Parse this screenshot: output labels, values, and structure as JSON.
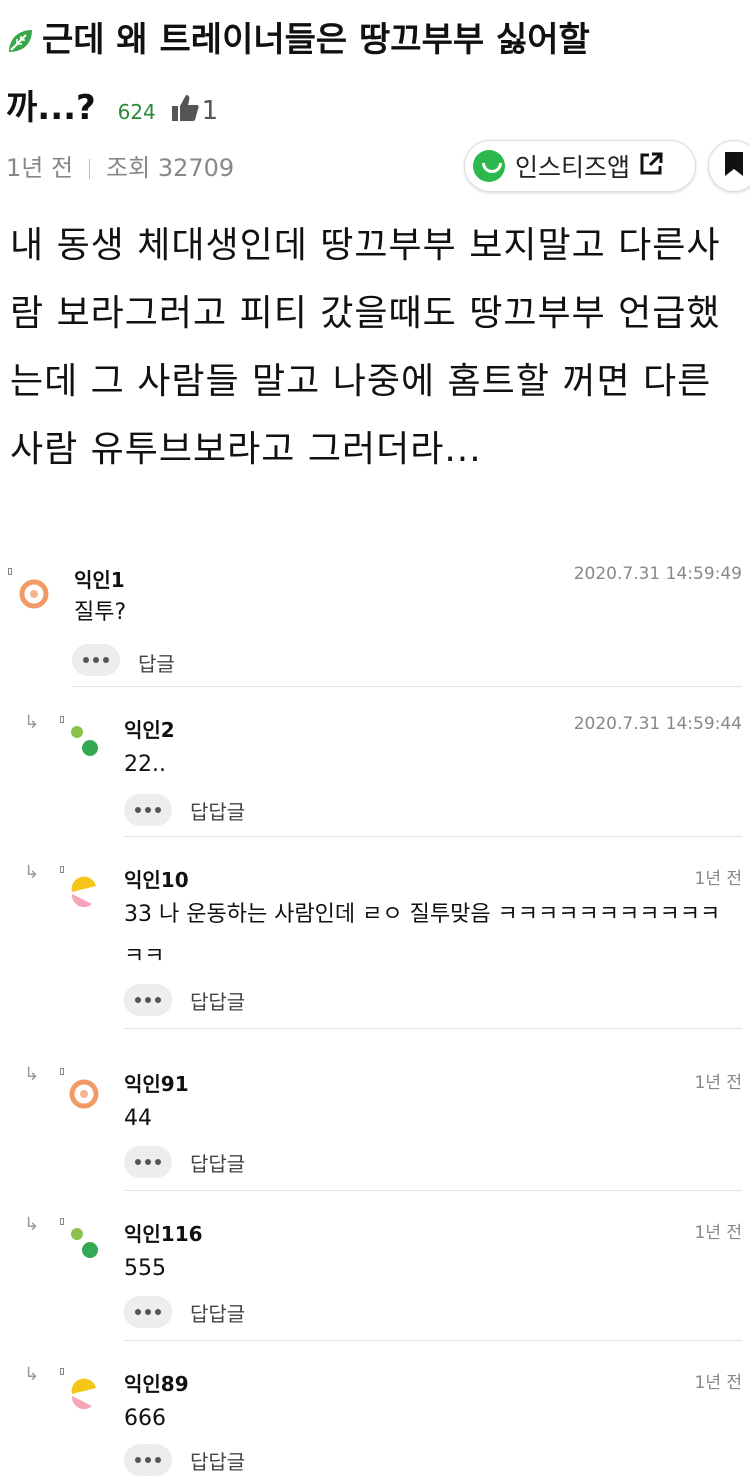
{
  "post": {
    "title_line1": "근데 왜 트레이너들은 땅끄부부 싫어할",
    "title_line2": "까...?",
    "comment_count": "624",
    "likes": "1",
    "time": "1년 전",
    "views": "조회 32709",
    "app_button_label": "인스티즈앱",
    "body": "내 동생 체대생인데 땅끄부부 보지말고 다른사람 보라그러고 피티 갔을때도 땅끄부부 언급했는데 그 사람들 말고 나중에 홈트할 꺼면 다른사람 유투브보라고 그러더라..."
  },
  "colors": {
    "accent_green": "#2db84d",
    "count_green": "#2a8a3a"
  },
  "comments": [
    {
      "name": "익인1",
      "time": "2020.7.31 14:59:49",
      "text": "질투?",
      "reply": "답글",
      "avatar": "orange-ring"
    },
    {
      "name": "익인2",
      "time": "2020.7.31 14:59:44",
      "text": "22..",
      "reply": "답답글",
      "avatar": "green-dots"
    },
    {
      "name": "익인10",
      "time": "1년 전",
      "text": "33 나 운동하는 사람인데 ㄹㅇ 질투맞음 ㅋㅋㅋㅋㅋㅋㅋㅋㅋㅋㅋㅋㅋ",
      "reply": "답답글",
      "avatar": "yellow-pink"
    },
    {
      "name": "익인91",
      "time": "1년 전",
      "text": "44",
      "reply": "답답글",
      "avatar": "orange-ring"
    },
    {
      "name": "익인116",
      "time": "1년 전",
      "text": "555",
      "reply": "답답글",
      "avatar": "green-dots"
    },
    {
      "name": "익인89",
      "time": "1년 전",
      "text": "666",
      "reply": "답답글",
      "avatar": "yellow-pink"
    }
  ]
}
